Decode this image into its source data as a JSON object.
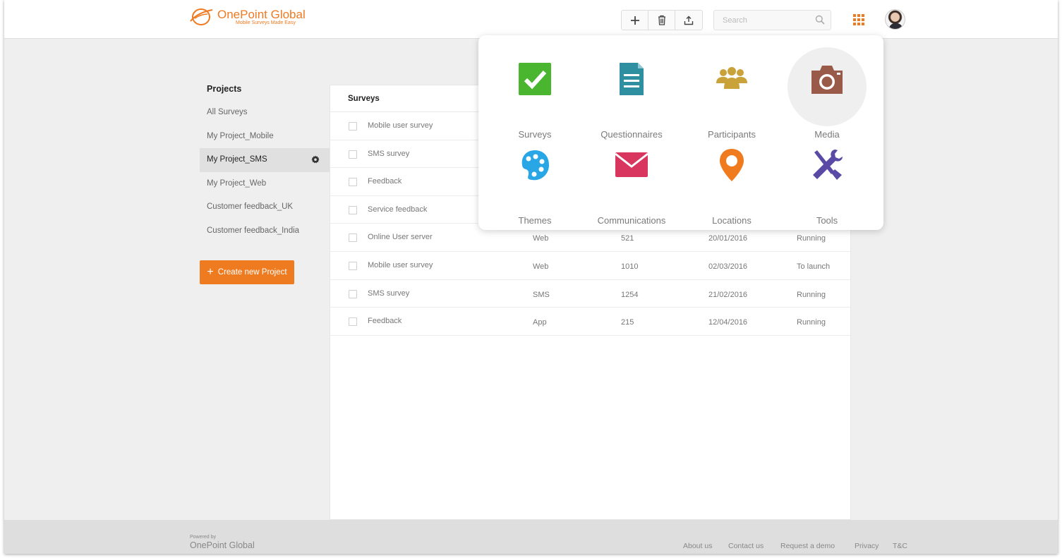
{
  "header": {
    "brand": "OnePoint Global",
    "tagline": "Mobile Surveys Made Easy",
    "search_placeholder": "Search",
    "toolbar": [
      "add-icon",
      "trash-icon",
      "upload-icon"
    ],
    "apps_icon": "grid-icon",
    "accent": "#ee7a22"
  },
  "sidebar": {
    "title": "Projects",
    "items": [
      "All Surveys",
      "My Project_Mobile",
      "My Project_SMS",
      "My Project_Web",
      "Customer feedback_UK",
      "Customer feedback_India"
    ],
    "active_item": "My Project_SMS",
    "create_button": "Create new Project"
  },
  "surveys": {
    "title": "Surveys",
    "rows": [
      {
        "name": "Mobile user survey",
        "channel": "",
        "responses": "",
        "date": "",
        "status": ""
      },
      {
        "name": "SMS survey",
        "channel": "",
        "responses": "",
        "date": "",
        "status": ""
      },
      {
        "name": "Feedback",
        "channel": "",
        "responses": "",
        "date": "",
        "status": ""
      },
      {
        "name": "Service feedback",
        "channel": "",
        "responses": "",
        "date": "",
        "status": ""
      },
      {
        "name": "Online User server",
        "channel": "Web",
        "responses": "521",
        "date": "20/01/2016",
        "status": "Running"
      },
      {
        "name": "Mobile user survey",
        "channel": "Web",
        "responses": "1010",
        "date": "02/03/2016",
        "status": "To launch"
      },
      {
        "name": "SMS survey",
        "channel": "SMS",
        "responses": "1254",
        "date": "21/02/2016",
        "status": "Running"
      },
      {
        "name": "Feedback",
        "channel": "App",
        "responses": "215",
        "date": "12/04/2016",
        "status": "Running"
      }
    ]
  },
  "apps_menu": {
    "items": [
      {
        "label": "Surveys",
        "icon": "checkbox-icon",
        "color": "#4ab52e"
      },
      {
        "label": "Questionnaires",
        "icon": "document-icon",
        "color": "#2e8fa0"
      },
      {
        "label": "Participants",
        "icon": "people-icon",
        "color": "#c9a23a"
      },
      {
        "label": "Media",
        "icon": "camera-icon",
        "color": "#9a5a4a"
      },
      {
        "label": "Themes",
        "icon": "palette-icon",
        "color": "#29a6e6"
      },
      {
        "label": "Communications",
        "icon": "envelope-icon",
        "color": "#d8365f"
      },
      {
        "label": "Locations",
        "icon": "map-pin-icon",
        "color": "#f07a1e"
      },
      {
        "label": "Tools",
        "icon": "tools-icon",
        "color": "#5a4aa6"
      }
    ],
    "highlighted": "Media"
  },
  "footer": {
    "powered_by": "Powered by",
    "brand": "OnePoint Global",
    "links": [
      "About us",
      "Contact us",
      "Request a demo",
      "Privacy",
      "T&C"
    ]
  }
}
